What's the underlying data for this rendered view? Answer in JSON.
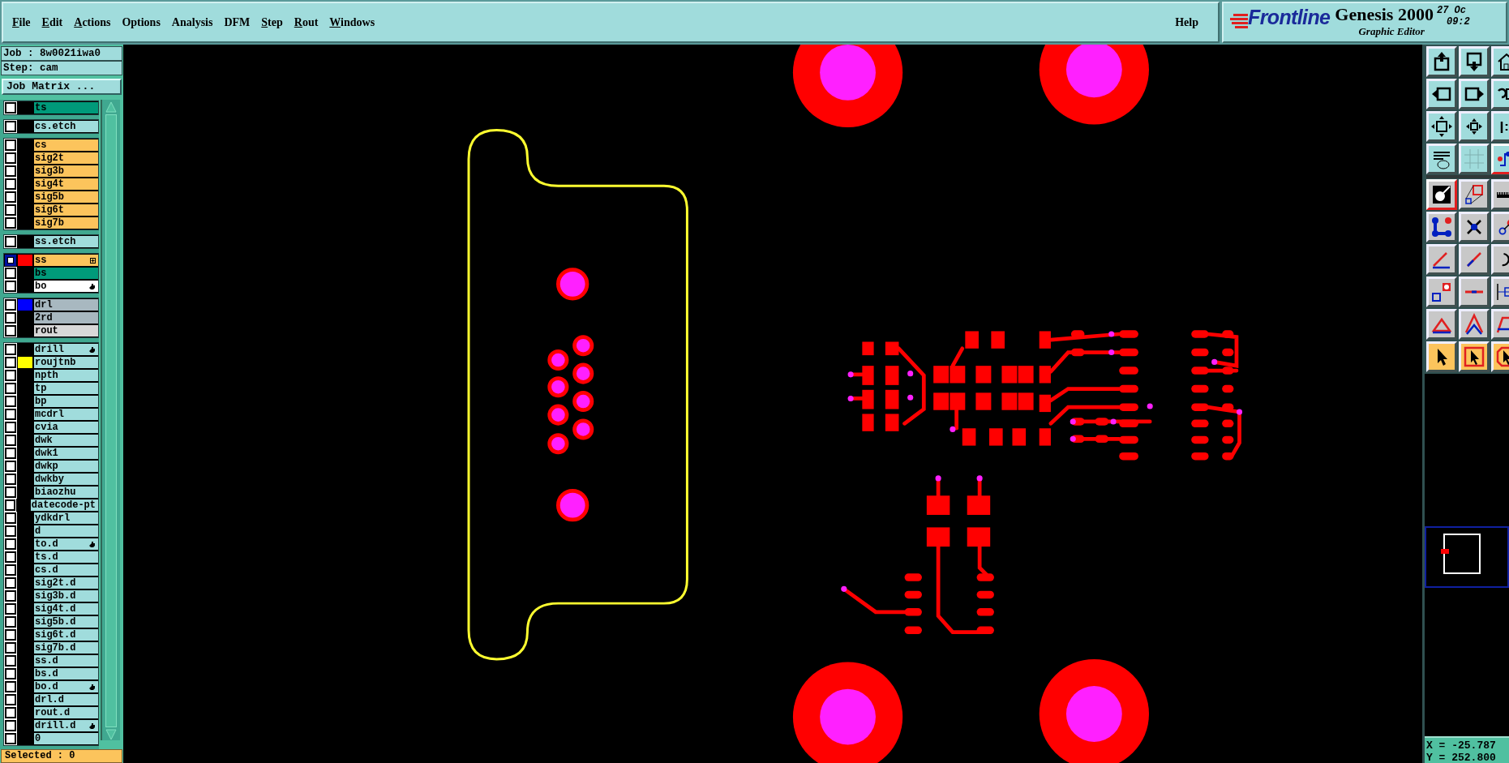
{
  "menu": [
    {
      "label": "File",
      "mnemonic": true
    },
    {
      "label": "Edit",
      "mnemonic": true
    },
    {
      "label": "Actions",
      "mnemonic": true
    },
    {
      "label": "Options",
      "mnemonic": false
    },
    {
      "label": "Analysis",
      "mnemonic": false
    },
    {
      "label": "DFM",
      "mnemonic": false
    },
    {
      "label": "Step",
      "mnemonic": true
    },
    {
      "label": "Rout",
      "mnemonic": true
    },
    {
      "label": "Windows",
      "mnemonic": true
    }
  ],
  "help": "Help",
  "branding": {
    "brand": "Frontline",
    "product": "Genesis 2000",
    "subtitle": "Graphic Editor",
    "date": "27 Oc",
    "time": "09:2"
  },
  "job": "Job : 8w0021iwa0",
  "step": "Step: cam",
  "job_matrix_button": "Job Matrix ...",
  "layer_groups": [
    [
      {
        "name": "ts",
        "color": "#009a7a",
        "selected": false
      }
    ],
    [
      {
        "name": "cs.etch",
        "color": "#a0dcdc",
        "selected": false
      }
    ],
    [
      {
        "name": "cs",
        "color": "#fcc45c",
        "selected": false
      },
      {
        "name": "sig2t",
        "color": "#fcc45c",
        "selected": false
      },
      {
        "name": "sig3b",
        "color": "#fcc45c",
        "selected": false
      },
      {
        "name": "sig4t",
        "color": "#fcc45c",
        "selected": false
      },
      {
        "name": "sig5b",
        "color": "#fcc45c",
        "selected": false
      },
      {
        "name": "sig6t",
        "color": "#fcc45c",
        "selected": false
      },
      {
        "name": "sig7b",
        "color": "#fcc45c",
        "selected": false
      }
    ],
    [
      {
        "name": "ss.etch",
        "color": "#a0dcdc",
        "selected": false
      }
    ],
    [
      {
        "name": "ss",
        "color": "#fcc45c",
        "swatch": {
          "color": "#ff0000"
        },
        "marker": {
          "kind": "plus"
        },
        "selected": true
      },
      {
        "name": "bs",
        "color": "#009a7a",
        "selected": false
      },
      {
        "name": "bo",
        "color": "#ffffff",
        "marker": {
          "kind": "hand"
        },
        "selected": false
      }
    ],
    [
      {
        "name": "drl",
        "color": "#a8b8c0",
        "swatch": {
          "color": "#0000ff"
        },
        "selected": false
      },
      {
        "name": "2rd",
        "color": "#a8b8c0",
        "selected": false
      },
      {
        "name": "rout",
        "color": "#d8d8d8",
        "selected": false
      }
    ],
    [
      {
        "name": "drill",
        "color": "#a0dcdc",
        "marker": {
          "kind": "hand"
        },
        "selected": false
      },
      {
        "name": "roujtnb",
        "color": "#a0dcdc",
        "swatch": {
          "color": "#ffff00"
        },
        "selected": false
      },
      {
        "name": "npth",
        "color": "#a0dcdc",
        "selected": false
      },
      {
        "name": "tp",
        "color": "#a0dcdc",
        "selected": false
      },
      {
        "name": "bp",
        "color": "#a0dcdc",
        "selected": false
      },
      {
        "name": "mcdrl",
        "color": "#a0dcdc",
        "selected": false
      },
      {
        "name": "cvia",
        "color": "#a0dcdc",
        "selected": false
      },
      {
        "name": "dwk",
        "color": "#a0dcdc",
        "selected": false
      },
      {
        "name": "dwk1",
        "color": "#a0dcdc",
        "selected": false
      },
      {
        "name": "dwkp",
        "color": "#a0dcdc",
        "selected": false
      },
      {
        "name": "dwkby",
        "color": "#a0dcdc",
        "selected": false
      },
      {
        "name": "biaozhu",
        "color": "#a0dcdc",
        "selected": false
      },
      {
        "name": "datecode-pt",
        "color": "#a0dcdc",
        "selected": false
      },
      {
        "name": "ydkdrl",
        "color": "#a0dcdc",
        "selected": false
      },
      {
        "name": "d",
        "color": "#a0dcdc",
        "selected": false
      },
      {
        "name": "to.d",
        "color": "#a0dcdc",
        "marker": {
          "kind": "hand"
        },
        "selected": false
      },
      {
        "name": "ts.d",
        "color": "#a0dcdc",
        "selected": false
      },
      {
        "name": "cs.d",
        "color": "#a0dcdc",
        "selected": false
      },
      {
        "name": "sig2t.d",
        "color": "#a0dcdc",
        "selected": false
      },
      {
        "name": "sig3b.d",
        "color": "#a0dcdc",
        "selected": false
      },
      {
        "name": "sig4t.d",
        "color": "#a0dcdc",
        "selected": false
      },
      {
        "name": "sig5b.d",
        "color": "#a0dcdc",
        "selected": false
      },
      {
        "name": "sig6t.d",
        "color": "#a0dcdc",
        "selected": false
      },
      {
        "name": "sig7b.d",
        "color": "#a0dcdc",
        "selected": false
      },
      {
        "name": "ss.d",
        "color": "#a0dcdc",
        "selected": false
      },
      {
        "name": "bs.d",
        "color": "#a0dcdc",
        "selected": false
      },
      {
        "name": "bo.d",
        "color": "#a0dcdc",
        "marker": {
          "kind": "hand"
        },
        "selected": false
      },
      {
        "name": "drl.d",
        "color": "#a0dcdc",
        "selected": false
      },
      {
        "name": "rout.d",
        "color": "#a0dcdc",
        "selected": false
      },
      {
        "name": "drill.d",
        "color": "#a0dcdc",
        "marker": {
          "kind": "hand"
        },
        "selected": false
      },
      {
        "name": "0",
        "color": "#a0dcdc",
        "selected": false
      }
    ]
  ],
  "selected_count": "Selected : 0",
  "toolbar": [
    {
      "kind": "view",
      "selected": false
    },
    {
      "kind": "view",
      "selected": false
    },
    {
      "kind": "view",
      "selected": false
    },
    {
      "kind": "view",
      "selected": false
    },
    {
      "kind": "view",
      "selected": false
    },
    {
      "kind": "view",
      "selected": false
    },
    {
      "kind": "view",
      "selected": false
    },
    {
      "kind": "view",
      "selected": false
    },
    {
      "kind": "view",
      "selected": false
    },
    {
      "kind": "view",
      "selected": false
    },
    {
      "kind": "view",
      "selected": false
    },
    {
      "kind": "view",
      "selected": true
    },
    {
      "kind": "edit",
      "selected": true
    },
    {
      "kind": "edit",
      "selected": false
    },
    {
      "kind": "edit",
      "selected": false
    },
    {
      "kind": "edit",
      "selected": false
    },
    {
      "kind": "edit",
      "selected": false
    },
    {
      "kind": "edit",
      "selected": false
    },
    {
      "kind": "edit",
      "selected": false
    },
    {
      "kind": "edit",
      "selected": false
    },
    {
      "kind": "edit",
      "selected": false
    },
    {
      "kind": "edit",
      "selected": false
    },
    {
      "kind": "edit",
      "selected": false
    },
    {
      "kind": "edit",
      "selected": false
    },
    {
      "kind": "edit",
      "selected": false
    },
    {
      "kind": "edit",
      "selected": false
    },
    {
      "kind": "edit",
      "selected": false
    },
    {
      "kind": "select",
      "selected": false
    },
    {
      "kind": "select",
      "selected": false
    },
    {
      "kind": "select",
      "selected": false
    }
  ],
  "coordinates": {
    "x": "X = -25.787",
    "y": "Y = 252.800"
  }
}
